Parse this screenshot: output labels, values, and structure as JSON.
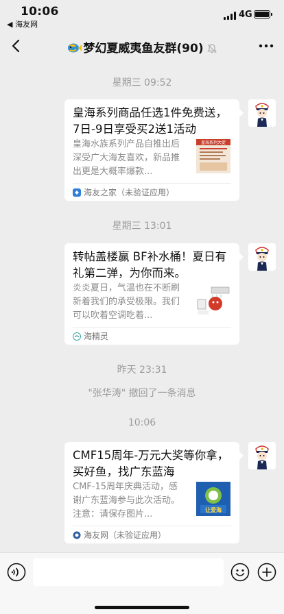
{
  "status_bar": {
    "time": "10:06",
    "back_app": "◀ 海友网",
    "network": "4G"
  },
  "nav": {
    "title": "梦幻夏威夷鱼友群(90)"
  },
  "messages": [
    {
      "timestamp": "星期三 09:52",
      "title": "皇海系列商品任选1件免费送，7日-9日享受买2送1活动",
      "desc": "皇海水族系列产品自推出后深受广大海友喜欢，新品推出更是大概率爆款...",
      "source": "海友之家（未验证应用）",
      "thumb_text": "皇海系列大促"
    },
    {
      "timestamp": "星期三 13:01",
      "title": "转帖盖楼赢 BF补水桶！夏日有礼第二弹，为你而来。",
      "desc": "炎炎夏日，气温也在不断刷新着我们的承受极限。我们可以吹着空调吃着...",
      "source": "海精灵"
    },
    {
      "timestamp": "昨天 23:31",
      "recall": "\"张华涛\" 撤回了一条消息"
    },
    {
      "timestamp": "10:06",
      "title": "CMF15周年-万元大奖等你拿，买好鱼，找广东蓝海",
      "desc": "CMF-15周年庆典活动，感谢广东蓝海参与此次活动。注意：请保存图片...",
      "source": "海友网（未验证应用）",
      "thumb_text": "让爱海"
    }
  ],
  "input": {
    "placeholder": ""
  },
  "colors": {
    "background": "#ededed",
    "card": "#ffffff",
    "timestamp": "#9b9b9b"
  }
}
